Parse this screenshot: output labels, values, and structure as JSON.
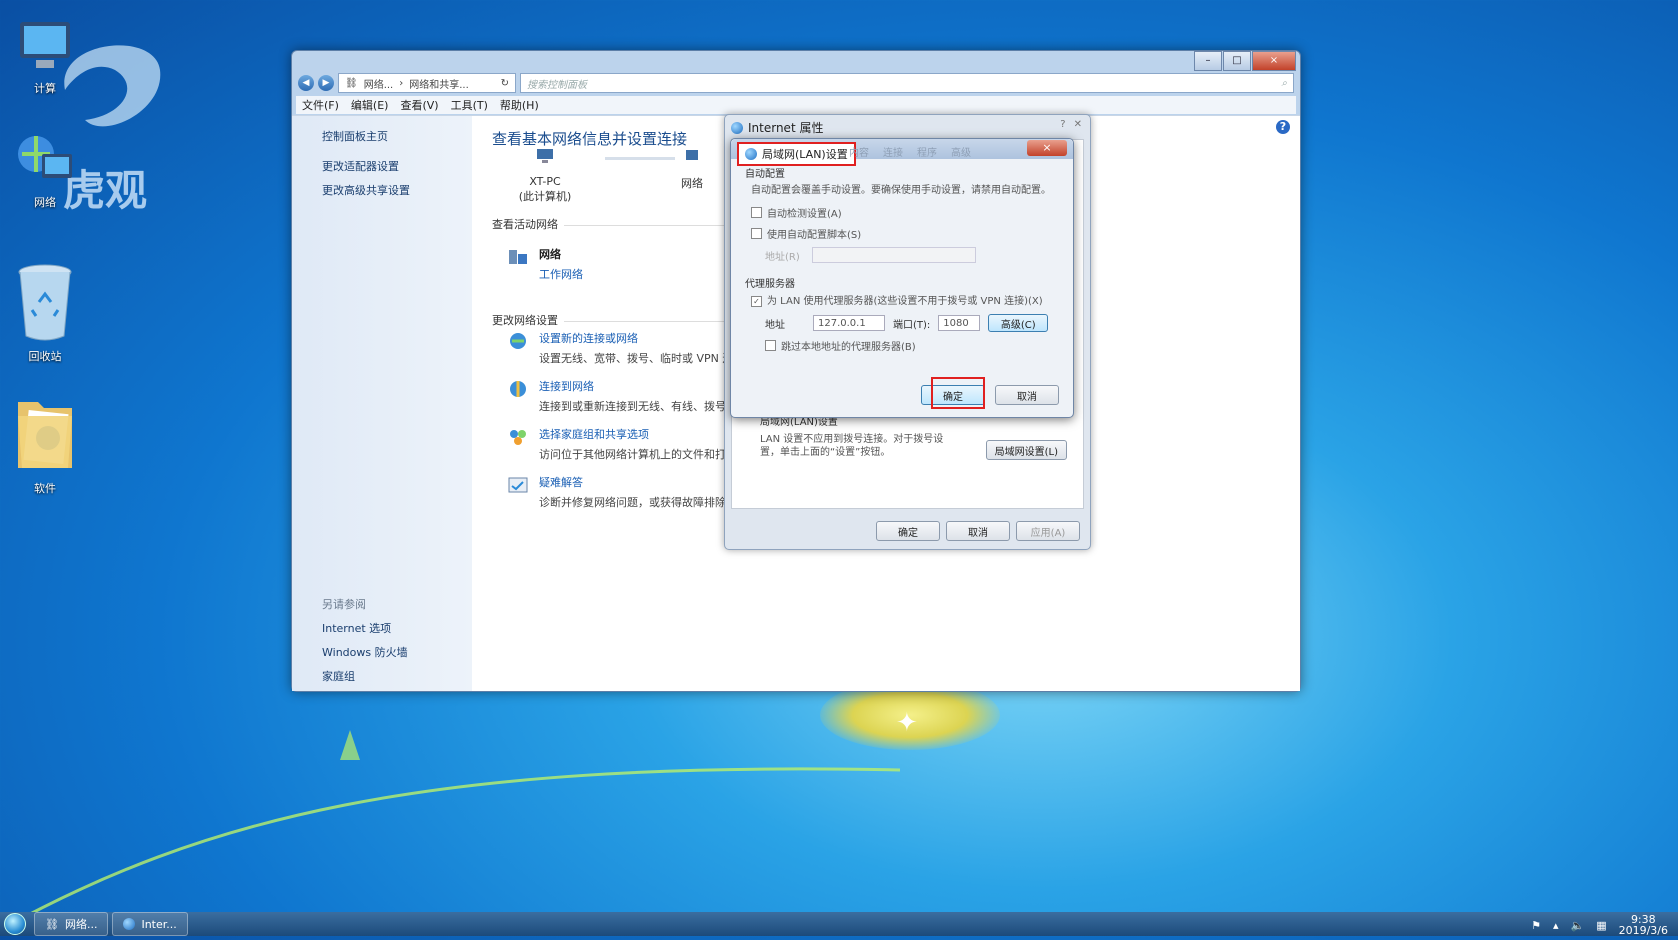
{
  "desktop": {
    "icons": [
      {
        "label": "计算"
      },
      {
        "label": "网络"
      },
      {
        "label": "回收站"
      },
      {
        "label": "软件"
      }
    ],
    "watermark_text": "虎观"
  },
  "window": {
    "caption": {
      "min": "–",
      "max": "□",
      "close": "×"
    },
    "address": {
      "crumb1": "网络...",
      "sep": "›",
      "crumb2": "网络和共享..."
    },
    "search_placeholder": "搜索控制面板",
    "menu": [
      "文件(F)",
      "编辑(E)",
      "查看(V)",
      "工具(T)",
      "帮助(H)"
    ],
    "sidebar": {
      "links": [
        "控制面板主页",
        "更改适配器设置",
        "更改高级共享设置"
      ],
      "see_also_header": "另请参阅",
      "see_also": [
        "Internet 选项",
        "Windows 防火墙",
        "家庭组"
      ]
    },
    "main": {
      "title": "查看基本网络信息并设置连接",
      "node1_name": "XT-PC",
      "node1_sub": "(此计算机)",
      "node2_name": "网络",
      "active_header": "查看活动网络",
      "network_name": "网络",
      "network_type": "工作网络",
      "change_header": "更改网络设置",
      "tasks": [
        {
          "title": "设置新的连接或网络",
          "desc": "设置无线、宽带、拨号、临时或 VPN 连"
        },
        {
          "title": "连接到网络",
          "desc": "连接到或重新连接到无线、有线、拨号网"
        },
        {
          "title": "选择家庭组和共享选项",
          "desc": "访问位于其他网络计算机上的文件和打印"
        },
        {
          "title": "疑难解答",
          "desc": "诊断并修复网络问题，或获得故障排除信"
        }
      ]
    }
  },
  "internet_properties": {
    "title": "Internet 属性",
    "lan_section_header": "局域网(LAN)设置",
    "lan_hint": "LAN 设置不应用到拨号连接。对于拨号设置，单击上面的“设置”按钮。",
    "lan_button": "局域网设置(L)",
    "ok": "确定",
    "cancel": "取消",
    "apply": "应用(A)"
  },
  "lan_dialog": {
    "title": "局域网(LAN)设置",
    "ghost_tabs": [
      "内容",
      "连接",
      "程序",
      "高级"
    ],
    "close": "×",
    "auto_header": "自动配置",
    "auto_desc": "自动配置会覆盖手动设置。要确保使用手动设置，请禁用自动配置。",
    "auto_detect": "自动检测设置(A)",
    "auto_script": "使用自动配置脚本(S)",
    "script_addr_label": "地址(R)",
    "proxy_header": "代理服务器",
    "proxy_use": "为 LAN 使用代理服务器(这些设置不用于拨号或 VPN 连接)(X)",
    "addr_label": "地址",
    "addr_value": "127.0.0.1",
    "port_label": "端口(T):",
    "port_value": "1080",
    "advanced": "高级(C)",
    "bypass_local": "跳过本地地址的代理服务器(B)",
    "ok": "确定",
    "cancel": "取消"
  },
  "taskbar": {
    "items": [
      "网络...",
      "Inter..."
    ],
    "time": "9:38",
    "date": "2019/3/6"
  }
}
